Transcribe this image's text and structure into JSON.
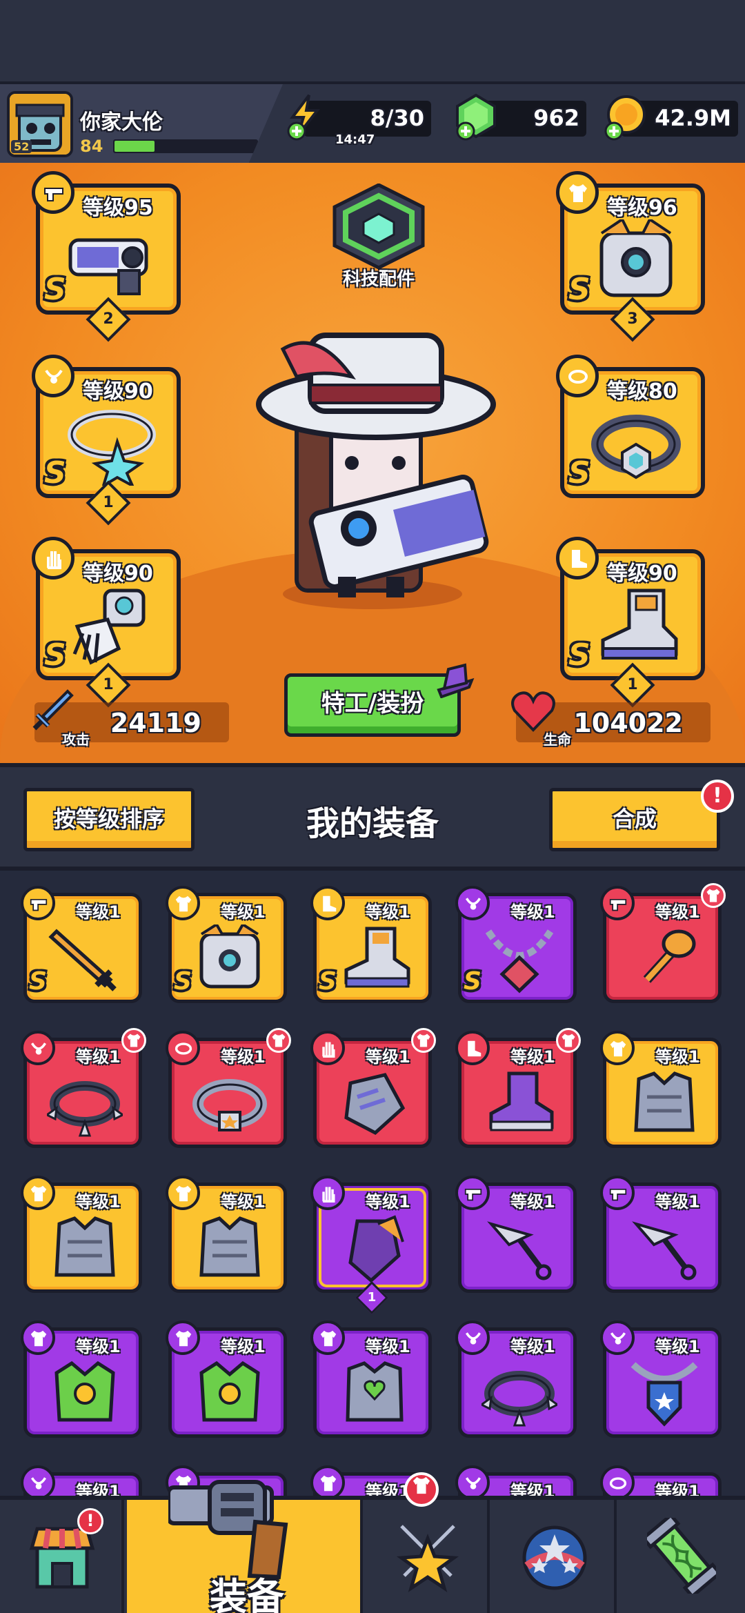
{
  "player": {
    "name": "你家大伦",
    "level": "84",
    "avatar_badge": "52",
    "xp_fraction": 0.28
  },
  "resources": {
    "energy": "8/30",
    "energy_timer": "14:47",
    "gems": "962",
    "gold": "42.9M"
  },
  "hero": {
    "tech_parts_label": "科技配件",
    "agent_button_label": "特工/装扮",
    "attack_label": "攻击",
    "attack_value": "24119",
    "hp_label": "生命",
    "hp_value": "104022"
  },
  "equipped": {
    "weapon": {
      "level": "等级95",
      "rank": "S",
      "stars": "2"
    },
    "necklace": {
      "level": "等级90",
      "rank": "S",
      "stars": "1"
    },
    "gloves": {
      "level": "等级90",
      "rank": "S",
      "stars": "1"
    },
    "armor": {
      "level": "等级96",
      "rank": "S",
      "stars": "3"
    },
    "belt": {
      "level": "等级80",
      "rank": "S",
      "stars": ""
    },
    "boots": {
      "level": "等级90",
      "rank": "S",
      "stars": "1"
    }
  },
  "equipment_panel": {
    "sort_button": "按等级排序",
    "title": "我的装备",
    "craft_button": "合成",
    "craft_alert": "!"
  },
  "inventory": [
    {
      "type": "weapon",
      "rarity": "gold",
      "level": "等级1",
      "rank": "S",
      "art": "sword-icon"
    },
    {
      "type": "armor",
      "rarity": "gold",
      "level": "等级1",
      "rank": "S",
      "art": "mech-armor-icon"
    },
    {
      "type": "boots",
      "rarity": "gold",
      "level": "等级1",
      "rank": "S",
      "art": "mech-boots-icon"
    },
    {
      "type": "necklace",
      "rarity": "purple",
      "level": "等级1",
      "rank": "S",
      "art": "chain-necklace-icon"
    },
    {
      "type": "weapon",
      "rarity": "red",
      "level": "等级1",
      "rank": "",
      "art": "mace-icon",
      "new": true
    },
    {
      "type": "necklace",
      "rarity": "red",
      "level": "等级1",
      "rank": "",
      "art": "spiked-collar-icon",
      "new": true
    },
    {
      "type": "belt",
      "rarity": "red",
      "level": "等级1",
      "rank": "",
      "art": "star-belt-icon",
      "new": true
    },
    {
      "type": "gloves",
      "rarity": "red",
      "level": "等级1",
      "rank": "",
      "art": "gauntlet-icon",
      "new": true
    },
    {
      "type": "boots",
      "rarity": "red",
      "level": "等级1",
      "rank": "",
      "art": "sneaker-icon",
      "new": true
    },
    {
      "type": "armor",
      "rarity": "gold",
      "level": "等级1",
      "rank": "",
      "art": "plate-armor-icon"
    },
    {
      "type": "armor",
      "rarity": "gold",
      "level": "等级1",
      "rank": "",
      "art": "plate-armor-icon"
    },
    {
      "type": "armor",
      "rarity": "gold",
      "level": "等级1",
      "rank": "",
      "art": "plate-armor-icon"
    },
    {
      "type": "gloves",
      "rarity": "purple",
      "level": "等级1",
      "rank": "",
      "art": "claw-glove-icon",
      "equipped": true,
      "stars": "1"
    },
    {
      "type": "weapon",
      "rarity": "purple",
      "level": "等级1",
      "rank": "",
      "art": "kunai-icon"
    },
    {
      "type": "weapon",
      "rarity": "purple",
      "level": "等级1",
      "rank": "",
      "art": "kunai-icon"
    },
    {
      "type": "armor",
      "rarity": "purple",
      "level": "等级1",
      "rank": "",
      "art": "dragon-armor-icon"
    },
    {
      "type": "armor",
      "rarity": "purple",
      "level": "等级1",
      "rank": "",
      "art": "dragon-armor-icon"
    },
    {
      "type": "armor",
      "rarity": "purple",
      "level": "等级1",
      "rank": "",
      "art": "heart-armor-icon"
    },
    {
      "type": "necklace",
      "rarity": "purple",
      "level": "等级1",
      "rank": "",
      "art": "spiked-collar-icon"
    },
    {
      "type": "necklace",
      "rarity": "purple",
      "level": "等级1",
      "rank": "",
      "art": "shield-pendant-icon"
    },
    {
      "type": "necklace",
      "rarity": "purple",
      "level": "等级1",
      "rank": "",
      "art": "partial"
    },
    {
      "type": "armor",
      "rarity": "purple",
      "level": "等级1",
      "rank": "",
      "art": "partial"
    },
    {
      "type": "armor",
      "rarity": "purple",
      "level": "等级1",
      "rank": "",
      "art": "partial"
    },
    {
      "type": "necklace",
      "rarity": "purple",
      "level": "等级1",
      "rank": "",
      "art": "partial"
    },
    {
      "type": "belt",
      "rarity": "purple",
      "level": "等级1",
      "rank": "",
      "art": "partial"
    }
  ],
  "nav": {
    "shop_alert": "!",
    "equip_label": "装备",
    "equip_alert": "armor-icon"
  },
  "colors": {
    "gold_card": "#fcc32f",
    "purple_card": "#a13ae6",
    "red_card": "#ec4159",
    "orange_bg": "#f28b22",
    "green_button": "#6ad84a"
  }
}
